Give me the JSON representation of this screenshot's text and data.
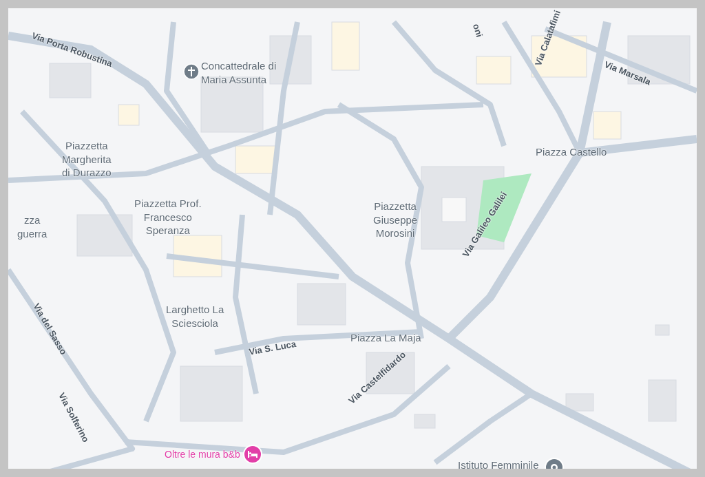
{
  "labels": [
    {
      "kind": "street",
      "text": "Via Porta Robustina"
    },
    {
      "kind": "poi",
      "text": "Concattedrale di\nMaria Assunta"
    },
    {
      "kind": "street",
      "text": "oni"
    },
    {
      "kind": "street",
      "text": "Via Calatafimi"
    },
    {
      "kind": "street",
      "text": "Via Marsala"
    },
    {
      "kind": "place",
      "text": "Piazza Castello"
    },
    {
      "kind": "place",
      "text": "Piazzetta\nMargherita\ndi Durazzo"
    },
    {
      "kind": "place",
      "text": "zza\nguerra"
    },
    {
      "kind": "place",
      "text": "Piazzetta Prof.\nFrancesco\nSperanza"
    },
    {
      "kind": "place",
      "text": "Piazzetta\nGiuseppe\nMorosini"
    },
    {
      "kind": "street",
      "text": "Via Galileo Galilei"
    },
    {
      "kind": "street",
      "text": "Via del Sasso"
    },
    {
      "kind": "place",
      "text": "Larghetto La\nSciesciola"
    },
    {
      "kind": "street",
      "text": "Via S. Luca"
    },
    {
      "kind": "place",
      "text": "Piazza La Maja"
    },
    {
      "kind": "street",
      "text": "Via Solferino"
    },
    {
      "kind": "street",
      "text": "Via Castelfidardo"
    },
    {
      "kind": "hotel",
      "text": "Oltre le mura b&b"
    },
    {
      "kind": "school",
      "text": "Istituto Femminile"
    }
  ]
}
